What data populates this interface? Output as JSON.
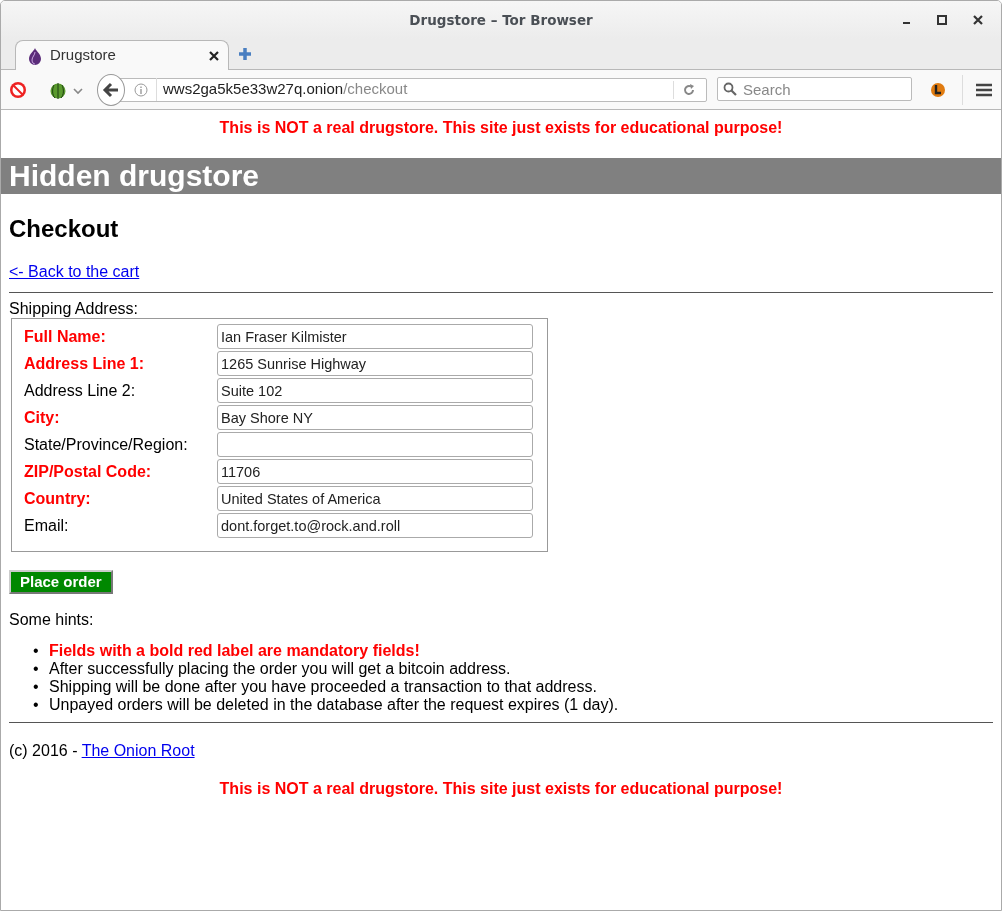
{
  "window": {
    "title": "Drugstore – Tor Browser"
  },
  "tabs": [
    {
      "label": "Drugstore",
      "selected": true
    }
  ],
  "toolbar": {
    "url_host": "wws2ga5k5e33w27q.onion",
    "url_path": "/checkout",
    "search_placeholder": "Search"
  },
  "page": {
    "notice_top": "This is NOT a real drugstore. This site just exists for educational purpose!",
    "site_title": "Hidden drugstore",
    "heading": "Checkout",
    "back_link": "<- Back to the cart",
    "section_label": "Shipping Address:",
    "fields": [
      {
        "label": "Full Name:",
        "required": true,
        "value": "Ian Fraser Kilmister"
      },
      {
        "label": "Address Line 1:",
        "required": true,
        "value": "1265 Sunrise Highway"
      },
      {
        "label": "Address Line 2:",
        "required": false,
        "value": "Suite 102"
      },
      {
        "label": "City:",
        "required": true,
        "value": "Bay Shore NY"
      },
      {
        "label": "State/Province/Region:",
        "required": false
      },
      {
        "label": "ZIP/Postal Code:",
        "required": true,
        "value": "11706"
      },
      {
        "label": "Country:",
        "required": true,
        "value": "United States of America"
      },
      {
        "label": "Email:",
        "required": false,
        "value": "dont.forget.to@rock.and.roll"
      }
    ],
    "submit": "Place order",
    "hints_label": "Some hints:",
    "hints": [
      {
        "marker": "•",
        "text": "Fields with a bold red label are mandatory fields!",
        "highlighted": true
      },
      {
        "marker": "•",
        "text": "After successfully placing the order you will get a bitcoin address.",
        "highlighted": false
      },
      {
        "marker": "•",
        "text": "Shipping will be done after you have proceeded a transaction to that address.",
        "highlighted": false
      },
      {
        "marker": "•",
        "text": "Unpayed orders will be deleted in the database after the request expires (1 day).",
        "highlighted": false
      }
    ],
    "footer_text": "(c) 2016 - ",
    "footer_link": "The Onion Root",
    "notice_bottom": "This is NOT a real drugstore. This site just exists for educational purpose!"
  }
}
